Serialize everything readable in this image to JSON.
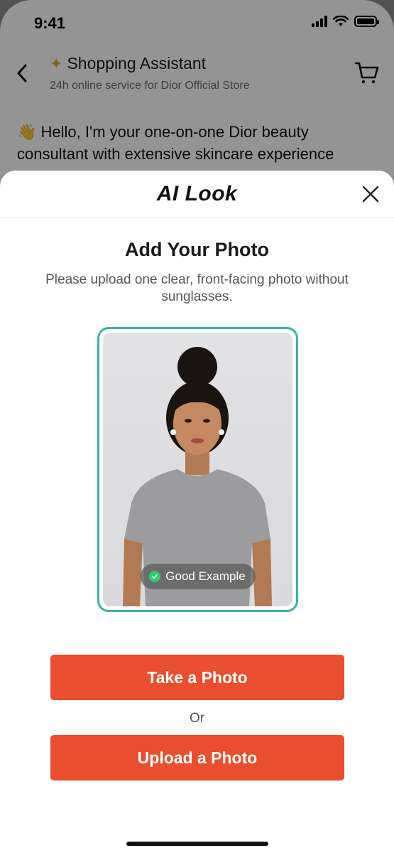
{
  "status_bar": {
    "time": "9:41"
  },
  "chat_header": {
    "title_icon": "sparkle-icon",
    "title": "Shopping Assistant",
    "subtitle": "24h online service for Dior Official Store"
  },
  "chat_message": {
    "emoji": "👋",
    "text": "Hello, I'm your one-on-one Dior beauty consultant with extensive skincare experience"
  },
  "sheet": {
    "title": "AI Look",
    "heading": "Add Your Photo",
    "description": "Please upload one clear, front-facing photo without sunglasses.",
    "badge_label": "Good Example",
    "take_photo_label": "Take a Photo",
    "or_label": "Or",
    "upload_photo_label": "Upload a Photo"
  },
  "colors": {
    "accent": "#e94e2e",
    "frame": "#3ab3a3",
    "check": "#2ecc71"
  }
}
